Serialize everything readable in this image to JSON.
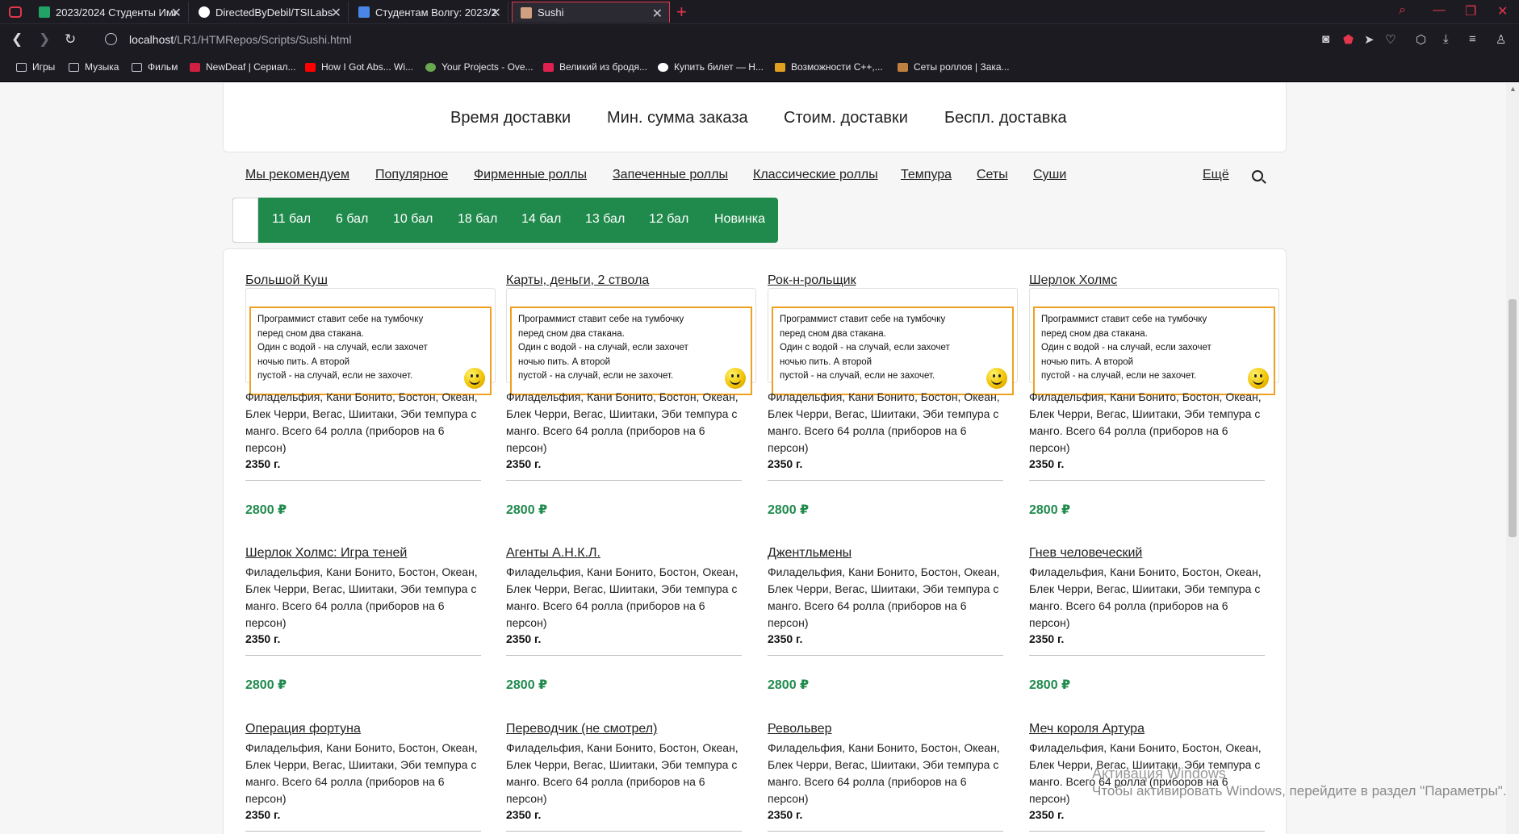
{
  "browser": {
    "tabs": [
      {
        "title": "2023/2024 Студенты Имит",
        "color": "#21a366"
      },
      {
        "title": "DirectedByDebil/TSILabs",
        "color": "#ffffff"
      },
      {
        "title": "Студентам Волгу: 2023/20",
        "color": "#4a86e8"
      },
      {
        "title": "Sushi",
        "color": "#d0a080"
      }
    ],
    "new_tab": "+",
    "url_host": "localhost",
    "url_path": "/LR1/HTMRepos/Scripts/Sushi.html",
    "bookmarks": [
      {
        "label": "Игры",
        "color": "folder"
      },
      {
        "label": "Музыка",
        "color": "folder"
      },
      {
        "label": "Фильм",
        "color": "folder"
      },
      {
        "label": "NewDeaf | Сериал...",
        "color": "#d02040"
      },
      {
        "label": "How I Got Abs... Wi...",
        "color": "#ff0000"
      },
      {
        "label": "Your Projects - Ove...",
        "color": "#6aa84f"
      },
      {
        "label": "Великий из бродя...",
        "color": "#e02050"
      },
      {
        "label": "Купить билет — Н...",
        "color": "#ffffff"
      },
      {
        "label": "Возможности C++,...",
        "color": "#e0a020"
      },
      {
        "label": "Сеты роллов | Зака...",
        "color": "#c08040"
      }
    ]
  },
  "info_bar": [
    "Время доставки",
    "Мин. сумма заказа",
    "Стоим. доставки",
    "Беспл. доставка"
  ],
  "categories": [
    "Мы рекомендуем",
    "Популярное",
    "Фирменные роллы",
    "Запеченные роллы",
    "Классические роллы",
    "Темпура",
    "Сеты",
    "Суши"
  ],
  "more_label": "Ещё",
  "filters": [
    "11 бал",
    "6 бал",
    "10 бал",
    "18 бал",
    "14 бал",
    "13 бал",
    "12 бал",
    "Новинка"
  ],
  "joke_lines": [
    "Программист ставит себе на тумбочку",
    "перед сном два стакана.",
    "Один с водой - на случай, если захочет",
    "ночью пить. А второй",
    "пустой - на случай, если не захочет."
  ],
  "products": [
    {
      "name": "Большой Куш",
      "desc": "Филадельфия, Кани Бонито, Бостон, Океан, Блек Черри, Вегас, Шиитаки, Эби темпура с манго. Всего 64 ролла (приборов на 6 персон)",
      "weight": "2350 г.",
      "price": "2800 ₽"
    },
    {
      "name": "Карты, деньги, 2 ствола",
      "desc": "Филадельфия, Кани Бонито, Бостон, Океан, Блек Черри, Вегас, Шиитаки, Эби темпура с манго. Всего 64 ролла (приборов на 6 персон)",
      "weight": "2350 г.",
      "price": "2800 ₽"
    },
    {
      "name": "Рок-н-рольщик",
      "desc": "Филадельфия, Кани Бонито, Бостон, Океан, Блек Черри, Вегас, Шиитаки, Эби темпура с манго. Всего 64 ролла (приборов на 6 персон)",
      "weight": "2350 г.",
      "price": "2800 ₽"
    },
    {
      "name": "Шерлок Холмс",
      "desc": "Филадельфия, Кани Бонито, Бостон, Океан, Блек Черри, Вегас, Шиитаки, Эби темпура с манго. Всего 64 ролла (приборов на 6 персон)",
      "weight": "2350 г.",
      "price": "2800 ₽"
    },
    {
      "name": "Шерлок Холмс: Игра теней",
      "desc": "Филадельфия, Кани Бонито, Бостон, Океан, Блек Черри, Вегас, Шиитаки, Эби темпура с манго. Всего 64 ролла (приборов на 6 персон)",
      "weight": "2350 г.",
      "price": "2800 ₽"
    },
    {
      "name": "Агенты А.Н.К.Л.",
      "desc": "Филадельфия, Кани Бонито, Бостон, Океан, Блек Черри, Вегас, Шиитаки, Эби темпура с манго. Всего 64 ролла (приборов на 6 персон)",
      "weight": "2350 г.",
      "price": "2800 ₽"
    },
    {
      "name": "Джентльмены",
      "desc": "Филадельфия, Кани Бонито, Бостон, Океан, Блек Черри, Вегас, Шиитаки, Эби темпура с манго. Всего 64 ролла (приборов на 6 персон)",
      "weight": "2350 г.",
      "price": "2800 ₽"
    },
    {
      "name": "Гнев человеческий",
      "desc": "Филадельфия, Кани Бонито, Бостон, Океан, Блек Черри, Вегас, Шиитаки, Эби темпура с манго. Всего 64 ролла (приборов на 6 персон)",
      "weight": "2350 г.",
      "price": "2800 ₽"
    },
    {
      "name": "Операция фортуна",
      "desc": "Филадельфия, Кани Бонито, Бостон, Океан, Блек Черри, Вегас, Шиитаки, Эби темпура с манго. Всего 64 ролла (приборов на 6 персон)",
      "weight": "2350 г.",
      "price": ""
    },
    {
      "name": "Переводчик (не смотрел)",
      "desc": "Филадельфия, Кани Бонито, Бостон, Океан, Блек Черри, Вегас, Шиитаки, Эби темпура с манго. Всего 64 ролла (приборов на 6 персон)",
      "weight": "2350 г.",
      "price": ""
    },
    {
      "name": "Револьвер",
      "desc": "Филадельфия, Кани Бонито, Бостон, Океан, Блек Черри, Вегас, Шиитаки, Эби темпура с манго. Всего 64 ролла (приборов на 6 персон)",
      "weight": "2350 г.",
      "price": ""
    },
    {
      "name": "Меч короля Артура",
      "desc": "Филадельфия, Кани Бонито, Бостон, Океан, Блек Черри, Вегас, Шиитаки, Эби темпура с манго. Всего 64 ролла (приборов на 6 персон)",
      "weight": "2350 г.",
      "price": ""
    }
  ],
  "watermark": {
    "line1": "Активация Windows",
    "line2": "Чтобы активировать Windows, перейдите в раздел \"Параметры\"."
  },
  "colors": {
    "accent_green": "#1f8a4c",
    "joke_border": "#f0a020",
    "browser_accent": "#e3364c"
  }
}
